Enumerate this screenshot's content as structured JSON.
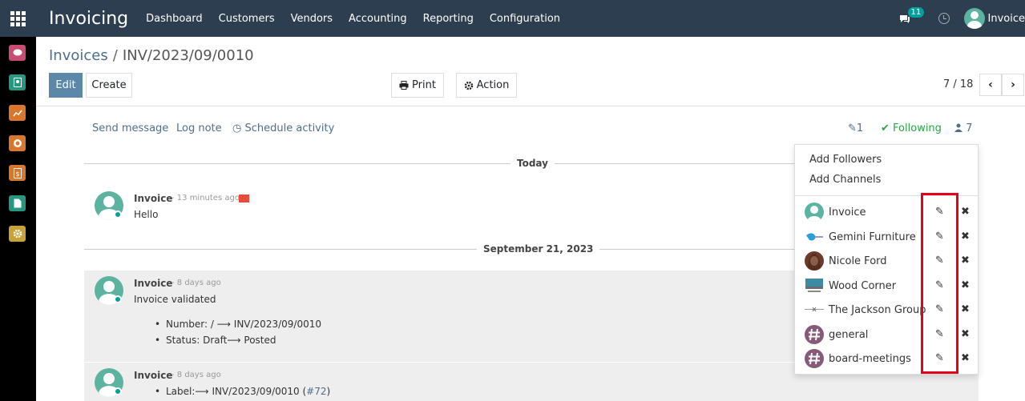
{
  "app": {
    "title": "Invoicing"
  },
  "menu": [
    "Dashboard",
    "Customers",
    "Vendors",
    "Accounting",
    "Reporting",
    "Configuration"
  ],
  "topbar": {
    "chat_count": "11",
    "user_name": "Invoice"
  },
  "breadcrumb": {
    "parent": "Invoices",
    "separator": "/",
    "current": "INV/2023/09/0010"
  },
  "buttons": {
    "edit": "Edit",
    "create": "Create",
    "print": "Print",
    "action": "Action"
  },
  "pager": {
    "value": "7 / 18"
  },
  "chatter": {
    "send_message": "Send message",
    "log_note": "Log note",
    "schedule_activity": "Schedule activity",
    "attachments": "1",
    "following": "Following",
    "followers_count": "7"
  },
  "dates": {
    "today": "Today",
    "sep21": "September 21, 2023"
  },
  "messages": [
    {
      "author": "Invoice",
      "time": "- 13 minutes ago",
      "body": "Hello"
    },
    {
      "author": "Invoice",
      "time": "- 8 days ago",
      "body": "Invoice validated",
      "changes": [
        {
          "label": "Number:",
          "old": "/",
          "new": "INV/2023/09/0010"
        },
        {
          "label": "Status:",
          "old": "Draft",
          "new": "Posted"
        }
      ]
    },
    {
      "author": "Invoice",
      "time": "- 8 days ago",
      "label_change": "Label:",
      "label_value": "INV/2023/09/0010",
      "ref_open": "(",
      "ref": "#72",
      "ref_close": ")"
    }
  ],
  "followers_menu": {
    "add_followers": "Add Followers",
    "add_channels": "Add Channels",
    "followers": [
      {
        "name": "Invoice",
        "avatar": "person"
      },
      {
        "name": "Gemini Furniture",
        "avatar": "logo-bird"
      },
      {
        "name": "Nicole Ford",
        "avatar": "photo"
      },
      {
        "name": "Wood Corner",
        "avatar": "logo-wood"
      },
      {
        "name": "The Jackson Group",
        "avatar": "logo-line"
      },
      {
        "name": "general",
        "avatar": "channel-hash"
      },
      {
        "name": "board-meetings",
        "avatar": "channel-hash"
      }
    ]
  },
  "colors": {
    "navbar": "#2c3e50",
    "primary": "#5b87a8",
    "following": "#28a745",
    "highlight": "#e3001b"
  }
}
